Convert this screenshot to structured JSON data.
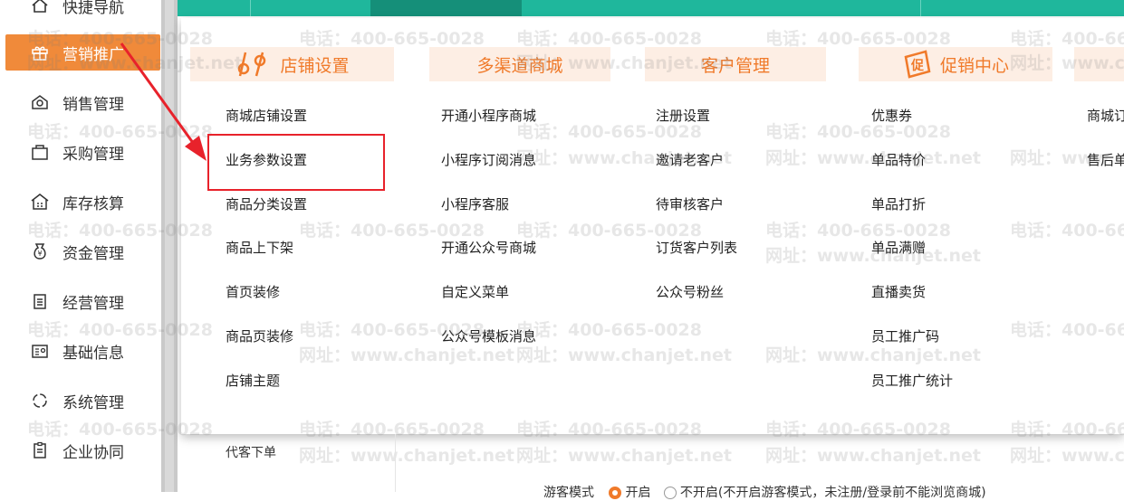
{
  "sidebar": {
    "items": [
      {
        "label": "快捷导航",
        "icon": "home-icon"
      },
      {
        "label": "营销推广",
        "icon": "gift-icon",
        "active": true
      },
      {
        "label": "销售管理",
        "icon": "sales-icon"
      },
      {
        "label": "采购管理",
        "icon": "bag-icon"
      },
      {
        "label": "库存核算",
        "icon": "warehouse-icon"
      },
      {
        "label": "资金管理",
        "icon": "money-icon"
      },
      {
        "label": "经营管理",
        "icon": "clipboard-icon"
      },
      {
        "label": "基础信息",
        "icon": "id-card-icon"
      },
      {
        "label": "系统管理",
        "icon": "system-icon"
      },
      {
        "label": "企业协同",
        "icon": "collab-icon"
      }
    ]
  },
  "menu": {
    "columns": [
      {
        "title": "店铺设置",
        "items": [
          "商城店铺设置",
          "业务参数设置",
          "商品分类设置",
          "商品上下架",
          "首页装修",
          "商品页装修",
          "店铺主题"
        ]
      },
      {
        "title": "多渠道商城",
        "items": [
          "开通小程序商城",
          "小程序订阅消息",
          "小程序客服",
          "开通公众号商城",
          "自定义菜单",
          "公众号模板消息"
        ]
      },
      {
        "title": "客户管理",
        "items": [
          "注册设置",
          "邀请老客户",
          "待审核客户",
          "订货客户列表",
          "公众号粉丝"
        ]
      },
      {
        "title": "促销中心",
        "items": [
          "优惠券",
          "单品特价",
          "单品打折",
          "单品满赠",
          "直播卖货",
          "员工推广码",
          "员工推广统计"
        ]
      },
      {
        "title": "",
        "items": [
          "商城订",
          "售后单"
        ]
      }
    ]
  },
  "below": {
    "proxy_order": "代客下单",
    "visitor_mode_label": "游客模式",
    "option_on": "开启",
    "option_off": "不开启",
    "option_off_note": "(不开启游客模式，未注册/登录前不能浏览商城)"
  },
  "watermark": {
    "phone": "电话：400-665-0028",
    "site": "网址：www.chanjet.net"
  },
  "colors": {
    "accent": "#f07a2a",
    "topbar": "#1fb79c",
    "highlight": "#e8222b"
  }
}
